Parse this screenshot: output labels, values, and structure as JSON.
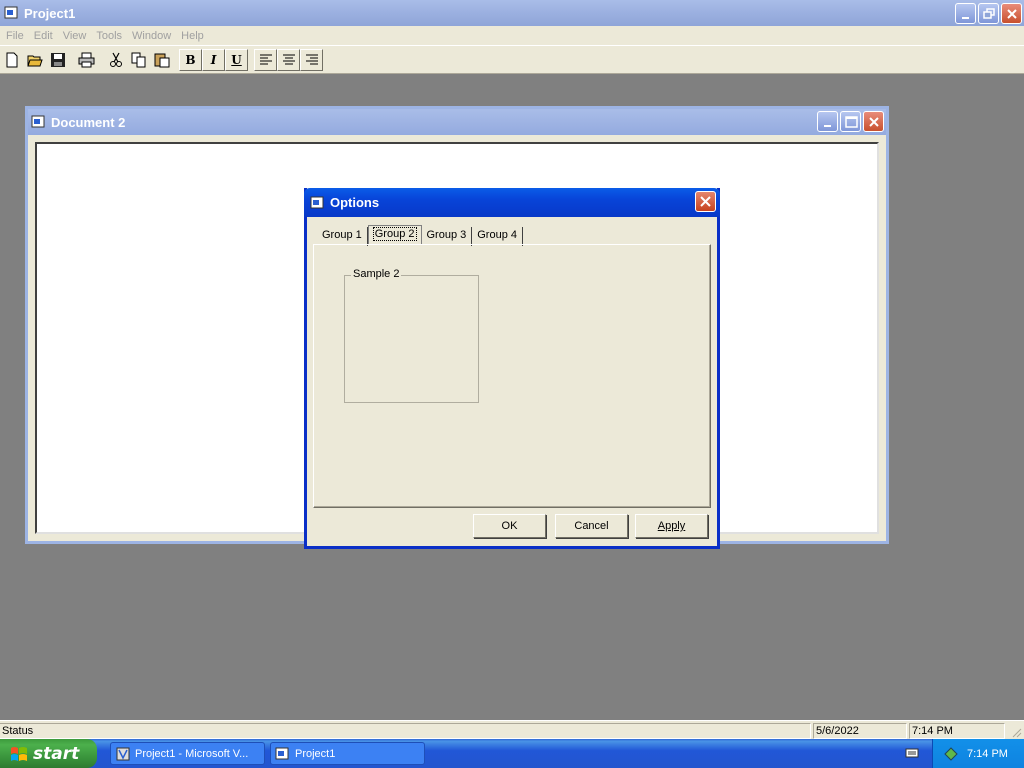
{
  "app": {
    "title": "Project1"
  },
  "menu": [
    "File",
    "Edit",
    "View",
    "Tools",
    "Window",
    "Help"
  ],
  "toolbar": {
    "bold_label": "B",
    "italic_label": "I",
    "underline_label": "U"
  },
  "document": {
    "title": "Document 2"
  },
  "dialog": {
    "title": "Options",
    "tabs": [
      "Group 1",
      "Group 2",
      "Group 3",
      "Group 4"
    ],
    "active_tab": "Group 2",
    "group_label": "Sample 2",
    "ok_label": "OK",
    "cancel_label": "Cancel",
    "apply_label": "Apply"
  },
  "statusbar": {
    "status": "Status",
    "date": "5/6/2022",
    "time": "7:14 PM"
  },
  "taskbar": {
    "start_label": "start",
    "tasks": [
      "Project1 - Microsoft V...",
      "Project1"
    ],
    "clock": "7:14 PM"
  },
  "colors": {
    "dialog_title_blue": "#0844d8",
    "mdi_background": "#808080",
    "inactive_title": "#9bb0e0"
  }
}
